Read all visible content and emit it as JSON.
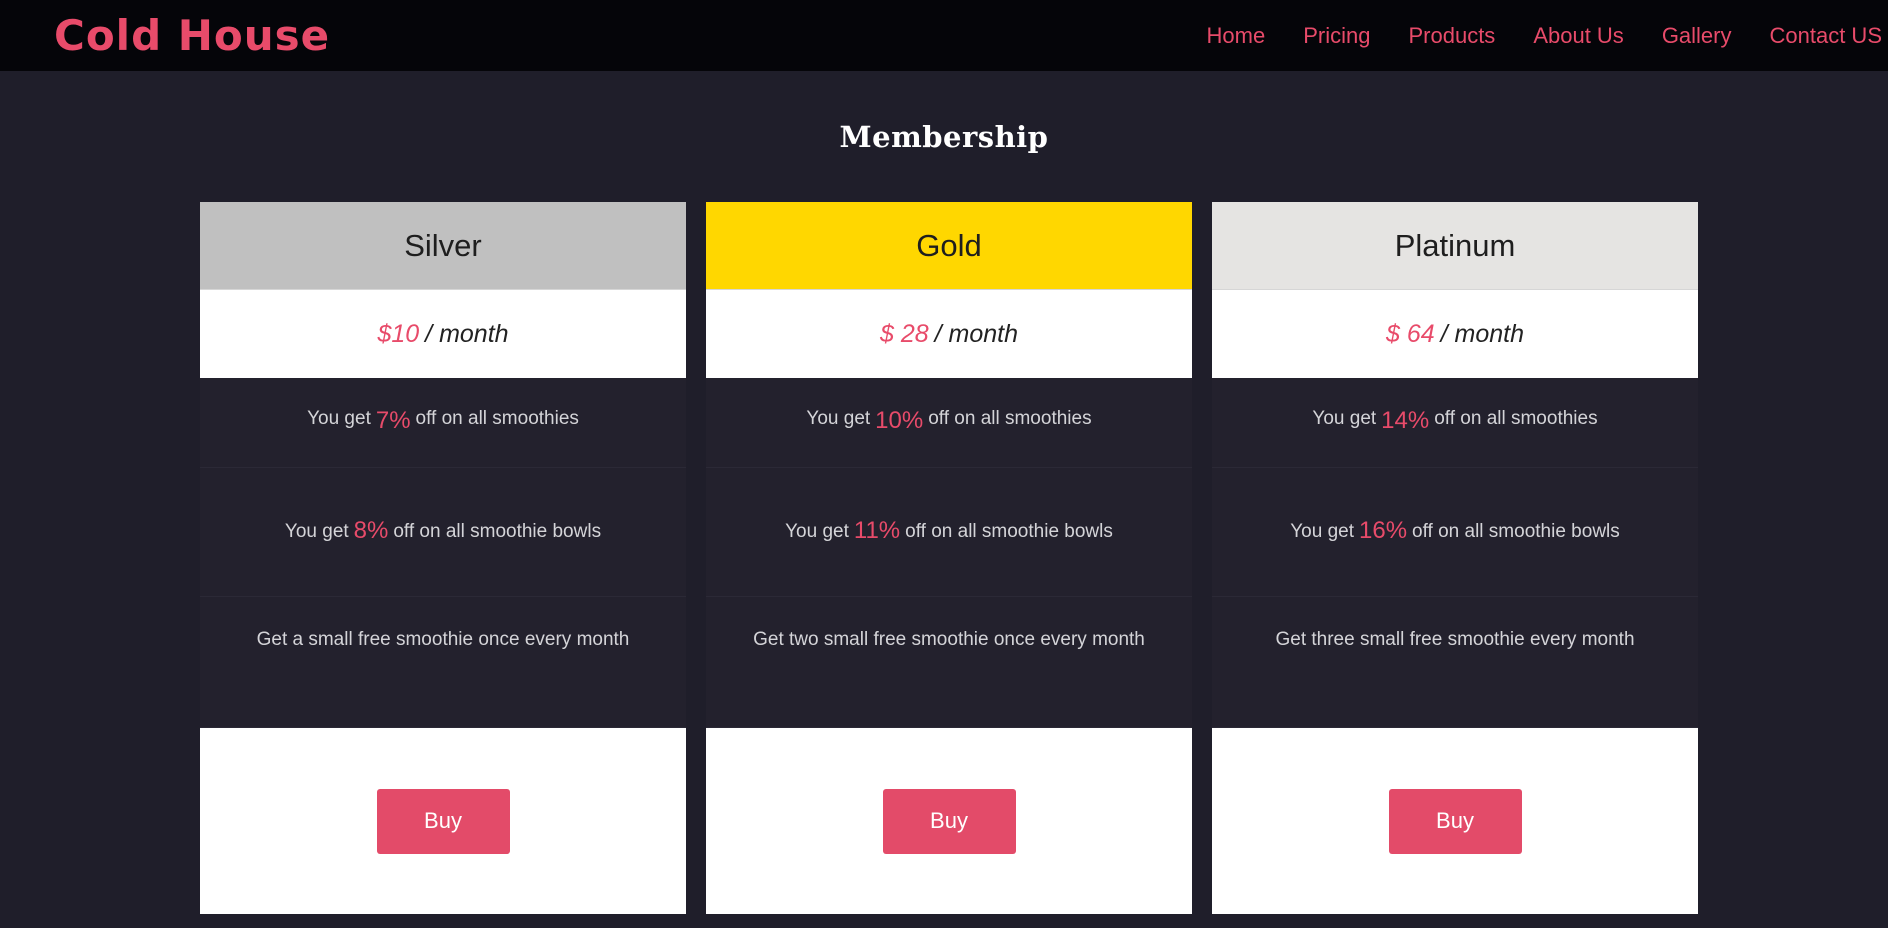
{
  "brand": {
    "name": "Cold House",
    "color": "#e84b6a"
  },
  "nav": {
    "items": [
      {
        "label": "Home"
      },
      {
        "label": "Pricing"
      },
      {
        "label": "Products"
      },
      {
        "label": "About Us"
      },
      {
        "label": "Gallery"
      },
      {
        "label": "Contact US"
      }
    ]
  },
  "section": {
    "title": "Membership"
  },
  "plans": [
    {
      "name": "Silver",
      "header_color": "#c0c0c0",
      "price": "$10",
      "period": "/ month",
      "smoothie": {
        "prefix": "You get",
        "pct": "7%",
        "suffix": "off on all smoothies"
      },
      "bowl": {
        "prefix": "You get",
        "pct": "8%",
        "suffix": "off on all smoothie bowls"
      },
      "free": "Get a small free smoothie once every month",
      "button": "Buy"
    },
    {
      "name": "Gold",
      "header_color": "#ffd700",
      "price": "$ 28",
      "period": "/ month",
      "smoothie": {
        "prefix": "You get",
        "pct": "10%",
        "suffix": "off on all smoothies"
      },
      "bowl": {
        "prefix": "You get",
        "pct": "11%",
        "suffix": "off on all smoothie bowls"
      },
      "free": "Get two small free smoothie once every month",
      "button": "Buy"
    },
    {
      "name": "Platinum",
      "header_color": "#e5e4e2",
      "price": "$ 64",
      "period": "/ month",
      "smoothie": {
        "prefix": "You get",
        "pct": "14%",
        "suffix": "off on all smoothies"
      },
      "bowl": {
        "prefix": "You get",
        "pct": "16%",
        "suffix": "off on all smoothie bowls"
      },
      "free": "Get three small free smoothie every month",
      "button": "Buy"
    }
  ]
}
